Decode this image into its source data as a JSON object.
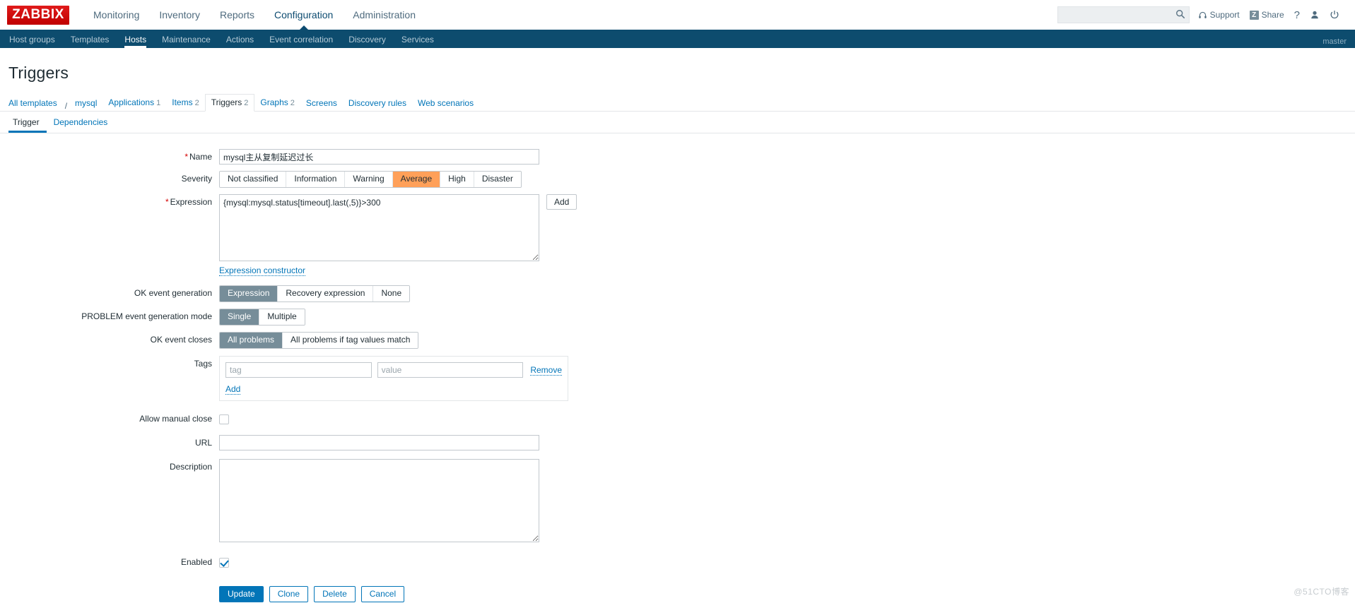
{
  "header": {
    "logo_text": "ZABBIX",
    "logo_color": "#d40000",
    "nav": [
      {
        "label": "Monitoring",
        "active": false
      },
      {
        "label": "Inventory",
        "active": false
      },
      {
        "label": "Reports",
        "active": false
      },
      {
        "label": "Configuration",
        "active": true
      },
      {
        "label": "Administration",
        "active": false
      }
    ],
    "search": {
      "value": "",
      "placeholder": ""
    },
    "support_label": "Support",
    "share_label": "Share",
    "share_badge": "Z",
    "help_label": "?",
    "user_icon": "user-icon",
    "signout_icon": "power-icon"
  },
  "subnav": {
    "items": [
      {
        "label": "Host groups",
        "active": false
      },
      {
        "label": "Templates",
        "active": false
      },
      {
        "label": "Hosts",
        "active": true
      },
      {
        "label": "Maintenance",
        "active": false
      },
      {
        "label": "Actions",
        "active": false
      },
      {
        "label": "Event correlation",
        "active": false
      },
      {
        "label": "Discovery",
        "active": false
      },
      {
        "label": "Services",
        "active": false
      }
    ],
    "server_name": "master",
    "background": "#0d4c6e"
  },
  "page": {
    "title": "Triggers"
  },
  "breadcrumb": {
    "root": "All templates",
    "separator": "/",
    "template": "mysql",
    "tabs": [
      {
        "label": "Applications",
        "count": "1",
        "selected": false
      },
      {
        "label": "Items",
        "count": "2",
        "selected": false
      },
      {
        "label": "Triggers",
        "count": "2",
        "selected": true
      },
      {
        "label": "Graphs",
        "count": "2",
        "selected": false
      },
      {
        "label": "Screens",
        "count": "",
        "selected": false
      },
      {
        "label": "Discovery rules",
        "count": "",
        "selected": false
      },
      {
        "label": "Web scenarios",
        "count": "",
        "selected": false
      }
    ]
  },
  "form_tabs": [
    {
      "label": "Trigger",
      "active": true
    },
    {
      "label": "Dependencies",
      "active": false
    }
  ],
  "form": {
    "name": {
      "label": "Name",
      "required": true,
      "value": "mysql主从复制延迟过长",
      "placeholder": ""
    },
    "severity": {
      "label": "Severity",
      "options": [
        "Not classified",
        "Information",
        "Warning",
        "Average",
        "High",
        "Disaster"
      ],
      "selected": "Average",
      "selected_color": "#ffa059"
    },
    "expression": {
      "label": "Expression",
      "required": true,
      "value": "{mysql:mysql.status[timeout].last(,5)}>300",
      "add_button": "Add",
      "constructor_link": "Expression constructor"
    },
    "ok_event_generation": {
      "label": "OK event generation",
      "options": [
        "Expression",
        "Recovery expression",
        "None"
      ],
      "selected": "Expression"
    },
    "problem_event_generation_mode": {
      "label": "PROBLEM event generation mode",
      "options": [
        "Single",
        "Multiple"
      ],
      "selected": "Single"
    },
    "ok_event_closes": {
      "label": "OK event closes",
      "options": [
        "All problems",
        "All problems if tag values match"
      ],
      "selected": "All problems"
    },
    "tags": {
      "label": "Tags",
      "rows": [
        {
          "tag_value": "",
          "tag_placeholder": "tag",
          "value_value": "",
          "value_placeholder": "value",
          "remove_label": "Remove"
        }
      ],
      "add_label": "Add"
    },
    "allow_manual_close": {
      "label": "Allow manual close",
      "checked": false
    },
    "url": {
      "label": "URL",
      "value": "",
      "placeholder": ""
    },
    "description": {
      "label": "Description",
      "value": "",
      "placeholder": ""
    },
    "enabled": {
      "label": "Enabled",
      "checked": true
    },
    "buttons": [
      {
        "label": "Update",
        "primary": true
      },
      {
        "label": "Clone",
        "primary": false
      },
      {
        "label": "Delete",
        "primary": false
      },
      {
        "label": "Cancel",
        "primary": false
      }
    ]
  },
  "watermark": "@51CTO博客"
}
